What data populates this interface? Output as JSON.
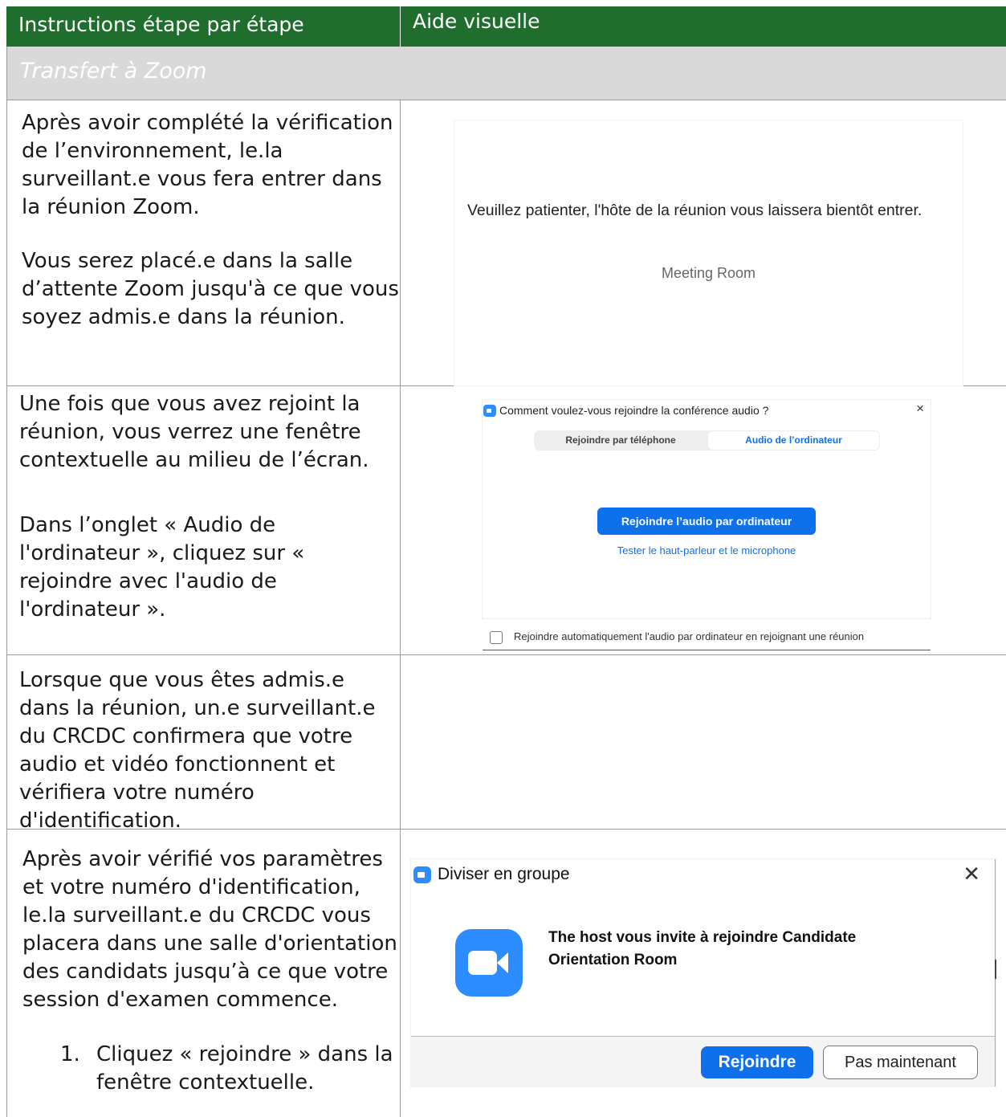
{
  "header": {
    "col_instructions": "Instructions étape par étape",
    "col_visual": "Aide visuelle"
  },
  "section": {
    "title": "Transfert à Zoom"
  },
  "row1": {
    "text_1": "Après avoir complété la vérification de l’environnement, le.la surveillant.e vous fera entrer dans la réunion Zoom.",
    "text_2": "Vous serez placé.e dans la salle d’attente Zoom jusqu'à ce que vous soyez admis.e dans la réunion.",
    "waiting_message": "Veuillez patienter, l'hôte de la réunion vous laissera bientôt entrer.",
    "waiting_room_label": "Meeting Room"
  },
  "row2": {
    "text_1": "Une fois que vous avez rejoint la réunion, vous verrez une fenêtre contextuelle au milieu de l’écran.",
    "text_2": "Dans l’onglet « Audio de l'ordinateur », cliquez sur « rejoindre avec l'audio de l'ordinateur ».",
    "dialog": {
      "title": "Comment voulez-vous rejoindre la conférence audio ?",
      "close": "×",
      "tab_phone": "Rejoindre par téléphone",
      "tab_computer": "Audio de l’ordinateur",
      "join_button": "Rejoindre l’audio par ordinateur",
      "test_link": "Tester le haut-parleur et le microphone",
      "auto_join_label": "Rejoindre automatiquement l'audio par ordinateur en rejoignant une réunion"
    }
  },
  "row3": {
    "text_1": "Lorsque que vous êtes admis.e dans la réunion, un.e surveillant.e du CRCDC confirmera que votre audio et vidéo fonctionnent et vérifiera votre numéro d'identification."
  },
  "row4": {
    "text_1": "Après avoir vérifié vos paramètres et votre numéro d'identification, le.la surveillant.e du CRCDC vous placera dans une salle d'orientation des candidats jusqu’à ce que votre session d'examen commence.",
    "list_item_number": "1.",
    "list_item_text": "Cliquez « rejoindre » dans la fenêtre contextuelle.",
    "dialog": {
      "title": "Diviser en groupe",
      "close": "✕",
      "message": "The host vous invite à rejoindre Candidate Orientation Room",
      "join_button": "Rejoindre",
      "later_button": "Pas maintenant"
    }
  }
}
